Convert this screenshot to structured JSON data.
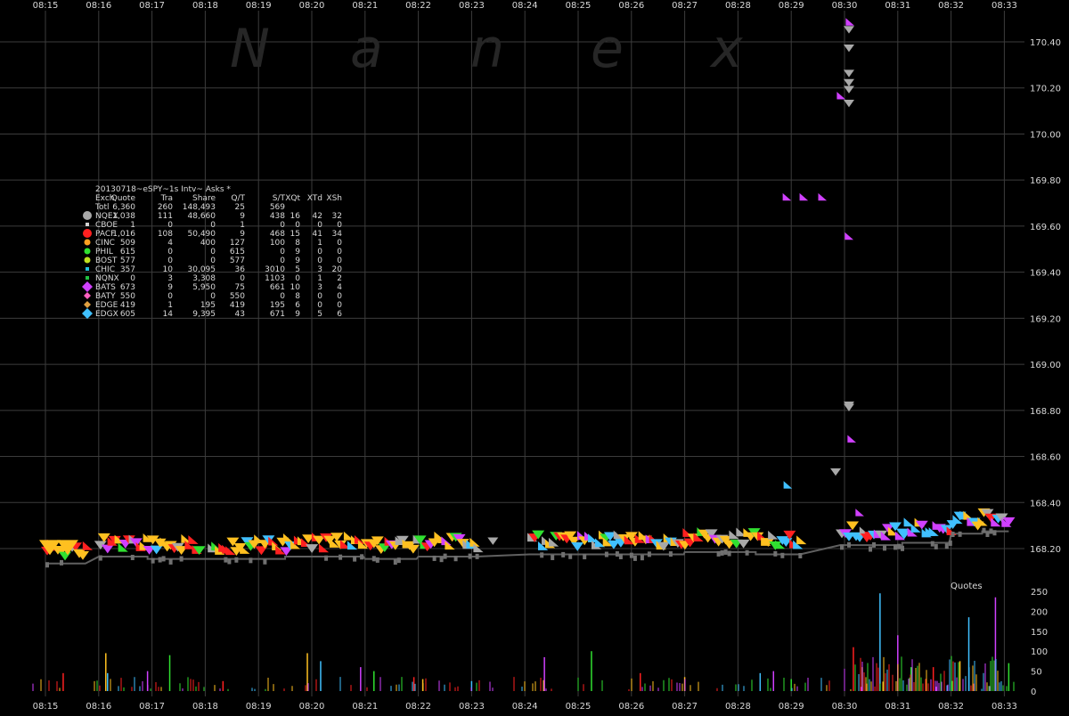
{
  "chart_data": {
    "type": "scatter",
    "watermark": "Nanex",
    "x_ticks": [
      "08:15",
      "08:16",
      "08:17",
      "08:18",
      "08:19",
      "08:20",
      "08:21",
      "08:22",
      "08:23",
      "08:24",
      "08:25",
      "08:26",
      "08:27",
      "08:28",
      "08:29",
      "08:30",
      "08:31",
      "08:32",
      "08:33"
    ],
    "price_axis": {
      "ticks": [
        168.2,
        168.4,
        168.6,
        168.8,
        169.0,
        169.2,
        169.4,
        169.6,
        169.8,
        170.0,
        170.2,
        170.4
      ],
      "tick_labels": [
        "168.20",
        "168.40",
        "168.60",
        "168.80",
        "169.00",
        "169.20",
        "169.40",
        "169.60",
        "169.80",
        "170.00",
        "170.20",
        "170.40"
      ],
      "ylim": [
        168.13,
        170.48
      ]
    },
    "volume_axis": {
      "label": "Quotes",
      "ticks": [
        0,
        50,
        100,
        150,
        200,
        250
      ],
      "ylim": [
        0,
        265
      ]
    },
    "legend": {
      "title": "20130718~eSPY~1s Intv~ Asks *",
      "columns": [
        "Exch",
        "Quote",
        "Tra",
        "Share",
        "Q/T",
        "S/T",
        "XQt",
        "XTd",
        "XSh"
      ],
      "total": [
        "Totl",
        "6,360",
        "260",
        "148,493",
        "25",
        "569",
        "",
        "",
        ""
      ],
      "rows": [
        {
          "exch": "NQEX",
          "color": "#a8a8a8",
          "marker": "circle-lg",
          "cells": [
            "1,038",
            "111",
            "48,660",
            "9",
            "438",
            "16",
            "42",
            "32"
          ]
        },
        {
          "exch": "CBOE",
          "color": "#d0d0d0",
          "marker": "dot",
          "cells": [
            "1",
            "0",
            "0",
            "1",
            "0",
            "0",
            "0",
            "0"
          ]
        },
        {
          "exch": "PACF",
          "color": "#ff2020",
          "marker": "octagon",
          "cells": [
            "1,016",
            "108",
            "50,490",
            "9",
            "468",
            "15",
            "41",
            "34"
          ]
        },
        {
          "exch": "CINC",
          "color": "#ffa020",
          "marker": "star",
          "cells": [
            "509",
            "4",
            "400",
            "127",
            "100",
            "8",
            "1",
            "0"
          ]
        },
        {
          "exch": "PHIL",
          "color": "#30e030",
          "marker": "circle",
          "cells": [
            "615",
            "0",
            "0",
            "615",
            "0",
            "9",
            "0",
            "0"
          ]
        },
        {
          "exch": "BOST",
          "color": "#c0e020",
          "marker": "circle",
          "cells": [
            "577",
            "0",
            "0",
            "577",
            "0",
            "9",
            "0",
            "0"
          ]
        },
        {
          "exch": "CHIC",
          "color": "#20c0e0",
          "marker": "dot",
          "cells": [
            "357",
            "10",
            "30,095",
            "36",
            "3010",
            "5",
            "3",
            "20"
          ]
        },
        {
          "exch": "NQNX",
          "color": "#20c040",
          "marker": "dot",
          "cells": [
            "0",
            "3",
            "3,308",
            "0",
            "1103",
            "0",
            "1",
            "2"
          ]
        },
        {
          "exch": "BATS",
          "color": "#d040ff",
          "marker": "diamond",
          "cells": [
            "673",
            "9",
            "5,950",
            "75",
            "661",
            "10",
            "3",
            "4"
          ]
        },
        {
          "exch": "BATY",
          "color": "#ff60c0",
          "marker": "diamond-sm",
          "cells": [
            "550",
            "0",
            "0",
            "550",
            "0",
            "8",
            "0",
            "0"
          ]
        },
        {
          "exch": "EDGE",
          "color": "#e0a040",
          "marker": "diamond-sm",
          "cells": [
            "419",
            "1",
            "195",
            "419",
            "195",
            "6",
            "0",
            "0"
          ]
        },
        {
          "exch": "EDGX",
          "color": "#40c0ff",
          "marker": "diamond",
          "cells": [
            "605",
            "14",
            "9,395",
            "43",
            "671",
            "9",
            "5",
            "6"
          ]
        }
      ]
    },
    "grid": true,
    "colors": {
      "background": "#000000",
      "grid": "#3c3c3c",
      "text": "#d8d8d8",
      "ask_yellow": "#ffc020",
      "ask_red": "#ff2020",
      "ask_purple": "#d040ff",
      "ask_blue": "#40c0ff",
      "ask_grey": "#a8a8a8",
      "ask_green": "#30e030",
      "best_bid": "#606060"
    },
    "segments": [
      {
        "start": "08:15:00",
        "end": "08:15:45",
        "level": 168.19
      },
      {
        "start": "08:16:00",
        "end": "08:16:55",
        "level": 168.22
      },
      {
        "start": "08:16:55",
        "end": "08:17:55",
        "level": 168.21
      },
      {
        "start": "08:18:05",
        "end": "08:19:30",
        "level": 168.21
      },
      {
        "start": "08:19:30",
        "end": "08:20:58",
        "level": 168.22
      },
      {
        "start": "08:21:00",
        "end": "08:21:58",
        "level": 168.21
      },
      {
        "start": "08:22:00",
        "end": "08:23:05",
        "level": 168.22
      },
      {
        "start": "08:24:05",
        "end": "08:25:30",
        "level": 168.23
      },
      {
        "start": "08:25:30",
        "end": "08:26:59",
        "level": 168.23
      },
      {
        "start": "08:27:00",
        "end": "08:28:20",
        "level": 168.24
      },
      {
        "start": "08:28:20",
        "end": "08:29:10",
        "level": 168.23
      },
      {
        "start": "08:29:55",
        "end": "08:31:05",
        "level": 168.27
      },
      {
        "start": "08:31:05",
        "end": "08:31:58",
        "level": 168.28
      },
      {
        "start": "08:32:00",
        "end": "08:32:35",
        "level": 168.32
      },
      {
        "start": "08:32:35",
        "end": "08:33:05",
        "level": 168.33
      }
    ],
    "spike_asks": [
      {
        "time": "08:28:54",
        "price": 169.72,
        "color": "#d040ff"
      },
      {
        "time": "08:29:13",
        "price": 169.72,
        "color": "#d040ff"
      },
      {
        "time": "08:29:34",
        "price": 169.72,
        "color": "#d040ff"
      },
      {
        "time": "08:30:04",
        "price": 169.55,
        "color": "#d040ff"
      },
      {
        "time": "08:29:55",
        "price": 170.16,
        "color": "#d040ff"
      },
      {
        "time": "08:30:07",
        "price": 168.67,
        "color": "#d040ff"
      },
      {
        "time": "08:30:16",
        "price": 168.35,
        "color": "#d040ff"
      },
      {
        "time": "08:28:55",
        "price": 168.47,
        "color": "#40c0ff"
      },
      {
        "time": "08:30:05",
        "price": 170.48,
        "color": "#d040ff"
      },
      {
        "time": "08:30:05",
        "price": 170.45,
        "color": "#a8a8a8"
      },
      {
        "time": "08:30:05",
        "price": 170.37,
        "color": "#a8a8a8"
      },
      {
        "time": "08:30:05",
        "price": 170.26,
        "color": "#a8a8a8"
      },
      {
        "time": "08:30:05",
        "price": 170.22,
        "color": "#a8a8a8"
      },
      {
        "time": "08:30:05",
        "price": 170.19,
        "color": "#a8a8a8"
      },
      {
        "time": "08:30:05",
        "price": 170.13,
        "color": "#a8a8a8"
      },
      {
        "time": "08:30:05",
        "price": 168.82,
        "color": "#a8a8a8"
      },
      {
        "time": "08:30:05",
        "price": 168.81,
        "color": "#a8a8a8"
      },
      {
        "time": "08:29:50",
        "price": 168.53,
        "color": "#a8a8a8"
      },
      {
        "time": "08:23:24",
        "price": 168.23,
        "color": "#a8a8a8"
      }
    ],
    "quote_spikes": [
      {
        "time": "08:15:20",
        "value": 45
      },
      {
        "time": "08:16:08",
        "value": 95
      },
      {
        "time": "08:16:10",
        "value": 45
      },
      {
        "time": "08:16:55",
        "value": 50
      },
      {
        "time": "08:17:20",
        "value": 90
      },
      {
        "time": "08:18:20",
        "value": 25
      },
      {
        "time": "08:19:55",
        "value": 95
      },
      {
        "time": "08:20:10",
        "value": 75
      },
      {
        "time": "08:20:55",
        "value": 60
      },
      {
        "time": "08:21:10",
        "value": 50
      },
      {
        "time": "08:21:55",
        "value": 35
      },
      {
        "time": "08:22:05",
        "value": 30
      },
      {
        "time": "08:23:00",
        "value": 25
      },
      {
        "time": "08:24:22",
        "value": 85
      },
      {
        "time": "08:25:15",
        "value": 100
      },
      {
        "time": "08:26:10",
        "value": 45
      },
      {
        "time": "08:27:00",
        "value": 35
      },
      {
        "time": "08:28:25",
        "value": 45
      },
      {
        "time": "08:28:40",
        "value": 50
      },
      {
        "time": "08:29:00",
        "value": 30
      },
      {
        "time": "08:30:10",
        "value": 110
      },
      {
        "time": "08:30:20",
        "value": 60
      },
      {
        "time": "08:30:40",
        "value": 245
      },
      {
        "time": "08:31:00",
        "value": 140
      },
      {
        "time": "08:31:15",
        "value": 60
      },
      {
        "time": "08:31:40",
        "value": 60
      },
      {
        "time": "08:32:10",
        "value": 75
      },
      {
        "time": "08:32:20",
        "value": 185
      },
      {
        "time": "08:32:50",
        "value": 235
      },
      {
        "time": "08:33:05",
        "value": 70
      }
    ]
  }
}
